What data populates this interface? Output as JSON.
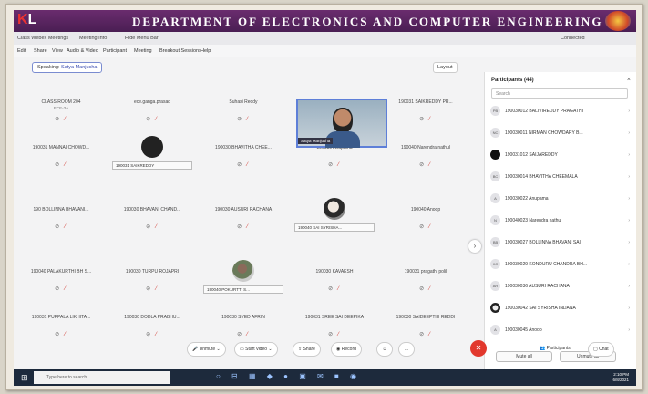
{
  "banner": {
    "logo_left": "K",
    "logo_right": "L",
    "department": "DEPARTMENT OF ELECTRONICS AND COMPUTER ENGINEERING"
  },
  "topbar": {
    "app_title": "Class Webex Meetings",
    "meeting_info": "Meeting Info",
    "hide_menu": "Hide Menu Bar",
    "connected": "Connected"
  },
  "menu": [
    "Edit",
    "Share",
    "View",
    "Audio & Video",
    "Participant",
    "Meeting",
    "Breakout Sessions",
    "Help"
  ],
  "speaking": {
    "label": "Speaking:",
    "name": "Satya Manjusha"
  },
  "layout_label": "Layout",
  "grid": [
    {
      "name": "CLASS ROOM 204",
      "sub": "ECE-3A",
      "kind": "plain"
    },
    {
      "name": "ece.ganga.prasad",
      "kind": "plain"
    },
    {
      "name": "Suhasi Reddy",
      "kind": "plain"
    },
    {
      "name": "190031 SAIKREDDY PR...",
      "kind": "plain"
    },
    {
      "name": "190031 MANNAI CHOWD...",
      "kind": "plain"
    },
    {
      "name": "190031 SAIKREDDY",
      "kind": "dark"
    },
    {
      "name": "190030 BHAVITHA CHEE...",
      "kind": "plain"
    },
    {
      "name": "190030 Anupama",
      "kind": "plain"
    },
    {
      "name": "190040 Narendra nathul",
      "kind": "plain"
    },
    {
      "name": "190 BOLLINNA BHAVANI...",
      "kind": "plain"
    },
    {
      "name": "190030 BHAVANI CHAND...",
      "kind": "plain"
    },
    {
      "name": "190030 AUSURI RACHANA",
      "kind": "plain"
    },
    {
      "name": "190040 SAI SYRISHA...",
      "kind": "photo"
    },
    {
      "name": "190040 Anoop",
      "kind": "plain"
    },
    {
      "name": "190040 PALAKURTHI BH S...",
      "kind": "plain"
    },
    {
      "name": "190030 TURPU ROJAPRI",
      "kind": "plain"
    },
    {
      "name": "190040 POKURTTI S...",
      "kind": "photo2"
    },
    {
      "name": "190030 KAVAESH",
      "kind": "plain"
    },
    {
      "name": "190031 pragathi polil",
      "kind": "plain"
    },
    {
      "name": "190031 PUPPALA LIKHITA...",
      "kind": "plain"
    },
    {
      "name": "190030 DODLA PRABHU...",
      "kind": "plain"
    },
    {
      "name": "190030 SYED AFRIN",
      "kind": "plain"
    },
    {
      "name": "190031 SREE SAI DEEPIKA",
      "kind": "plain"
    },
    {
      "name": "190030 SAIDEEPTHI REDDI",
      "kind": "plain"
    }
  ],
  "video_tile": {
    "name": "Satya Manjusha"
  },
  "panel": {
    "title": "Participants (44)",
    "search_placeholder": "Search",
    "participants": [
      {
        "name": "190030012 BALIVIREDDY PRAGATHI",
        "av": "PB"
      },
      {
        "name": "190030011 NIRMAN CHOWDARY B...",
        "av": "NC"
      },
      {
        "name": "190031012 SAIJAREDDY",
        "av": "dark"
      },
      {
        "name": "190030014 BHAVITHA CHEEMALA",
        "av": "BC"
      },
      {
        "name": "190030022 Anupama",
        "av": "A"
      },
      {
        "name": "190040023 Narendra nathul",
        "av": "N"
      },
      {
        "name": "190030027 BOLLINNA BHAVANI SAI",
        "av": "BB"
      },
      {
        "name": "190030029 KONDURU CHANDRA BH...",
        "av": "KC"
      },
      {
        "name": "190030036 AUSURI RACHANA",
        "av": "AR"
      },
      {
        "name": "190030042 SAI SYRISHA INDANA",
        "av": "img"
      },
      {
        "name": "190030045 Anoop",
        "av": "A"
      }
    ],
    "mute_all": "Mute all",
    "unmute_all": "Unmute all"
  },
  "controls": {
    "unmute": "Unmute",
    "start_video": "Start video",
    "share": "Share",
    "record": "Record",
    "participants": "Participants",
    "chat": "Chat"
  },
  "taskbar": {
    "search_placeholder": "Type here to search",
    "time": "2:10 PM",
    "date": "6/8/2021"
  }
}
